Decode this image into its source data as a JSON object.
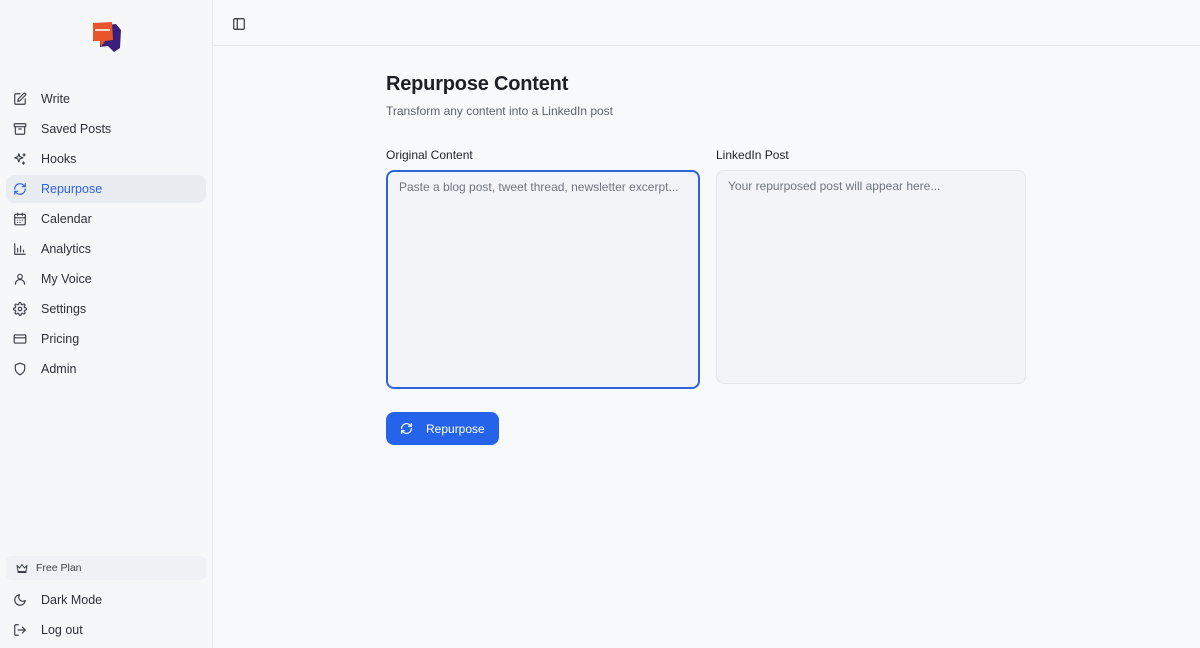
{
  "sidebar": {
    "items": [
      {
        "label": "Write",
        "icon": "pencil-square-icon"
      },
      {
        "label": "Saved Posts",
        "icon": "archive-icon"
      },
      {
        "label": "Hooks",
        "icon": "sparkles-icon"
      },
      {
        "label": "Repurpose",
        "icon": "refresh-icon",
        "active": true
      },
      {
        "label": "Calendar",
        "icon": "calendar-icon"
      },
      {
        "label": "Analytics",
        "icon": "bar-chart-icon"
      },
      {
        "label": "My Voice",
        "icon": "user-icon"
      },
      {
        "label": "Settings",
        "icon": "gear-icon"
      },
      {
        "label": "Pricing",
        "icon": "credit-card-icon"
      },
      {
        "label": "Admin",
        "icon": "shield-icon"
      }
    ],
    "plan_label": "Free Plan",
    "dark_mode_label": "Dark Mode",
    "logout_label": "Log out"
  },
  "main": {
    "title": "Repurpose Content",
    "subtitle": "Transform any content into a LinkedIn post",
    "original": {
      "label": "Original Content",
      "placeholder": "Paste a blog post, tweet thread, newsletter excerpt...",
      "value": ""
    },
    "output": {
      "label": "LinkedIn Post",
      "placeholder": "Your repurposed post will appear here..."
    },
    "button_label": "Repurpose"
  },
  "colors": {
    "accent": "#2563eb",
    "active_text": "#2d63e5",
    "logo_orange": "#e8552b",
    "logo_purple": "#3b1f7a"
  }
}
